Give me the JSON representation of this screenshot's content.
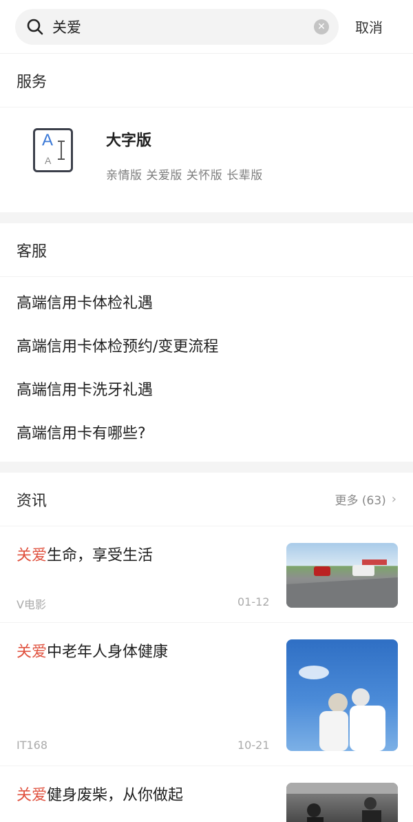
{
  "search": {
    "query": "关爱",
    "cancel_label": "取消"
  },
  "services": {
    "section_title": "服务",
    "card": {
      "title": "大字版",
      "subtitle": "亲情版 关爱版 关怀版 长辈版",
      "icon": "large-font-icon"
    }
  },
  "customer_service": {
    "section_title": "客服",
    "items": [
      "高端信用卡体检礼遇",
      "高端信用卡体检预约/变更流程",
      "高端信用卡洗牙礼遇",
      "高端信用卡有哪些?"
    ]
  },
  "news": {
    "section_title": "资讯",
    "more_label": "更多 (63)",
    "items": [
      {
        "highlight": "关爱",
        "rest": "生命，享受生活",
        "source": "V电影",
        "date": "01-12"
      },
      {
        "highlight": "关爱",
        "rest": "中老年人身体健康",
        "source": "IT168",
        "date": "10-21"
      },
      {
        "highlight": "关爱",
        "rest": "健身废柴，从你做起",
        "source": "",
        "date": ""
      }
    ]
  },
  "colors": {
    "highlight": "#e0523f",
    "icon_blue": "#3a78d6"
  }
}
